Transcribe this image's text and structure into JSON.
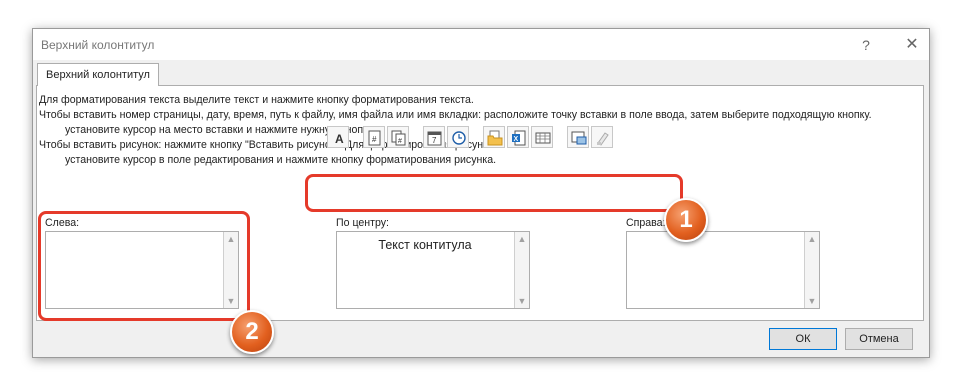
{
  "window": {
    "title": "Верхний колонтитул",
    "help_glyph": "?",
    "close_glyph": "✕"
  },
  "tab": {
    "label": "Верхний колонтитул"
  },
  "instructions": [
    "Для форматирования текста выделите текст и нажмите кнопку форматирования текста.",
    "Чтобы вставить номер страницы, дату, время, путь к файлу, имя файла или имя вкладки: расположите точку вставки в поле ввода, затем выберите подходящую кнопку.",
    "установите курсор на место вставки и нажмите нужную кнопку.",
    "Чтобы вставить рисунок: нажмите кнопку \"Вставить рисунок\". Для форматирования рисунка",
    "установите курсор в поле редактирования и нажмите кнопку форматирования рисунка."
  ],
  "toolbar": {
    "buttons": [
      {
        "name": "format-text-icon",
        "glyph": "A"
      },
      {
        "name": "insert-page-number-icon",
        "glyph": "#"
      },
      {
        "name": "insert-page-count-icon",
        "glyph": "#"
      },
      {
        "name": "insert-date-icon",
        "glyph": "7"
      },
      {
        "name": "insert-time-icon",
        "glyph": "clock"
      },
      {
        "name": "insert-file-path-icon",
        "glyph": "folder"
      },
      {
        "name": "insert-file-name-icon",
        "glyph": "x"
      },
      {
        "name": "insert-sheet-name-icon",
        "glyph": "grid"
      },
      {
        "name": "insert-picture-icon",
        "glyph": "picture"
      },
      {
        "name": "format-picture-icon",
        "glyph": "brush"
      }
    ]
  },
  "sections": {
    "left": {
      "label": "Слева:",
      "content": ""
    },
    "center": {
      "label": "По центру:",
      "content": "Текст контитула"
    },
    "right": {
      "label": "Справа:",
      "content": ""
    }
  },
  "buttons": {
    "ok": "ОК",
    "cancel": "Отмена"
  },
  "annotations": {
    "badge1": "1",
    "badge2": "2",
    "highlight_color": "#e53a2a",
    "badge_color": "#e2601f"
  },
  "colors": {
    "dialog_bg": "#f0f0f0",
    "focus_border": "#0078d7"
  }
}
